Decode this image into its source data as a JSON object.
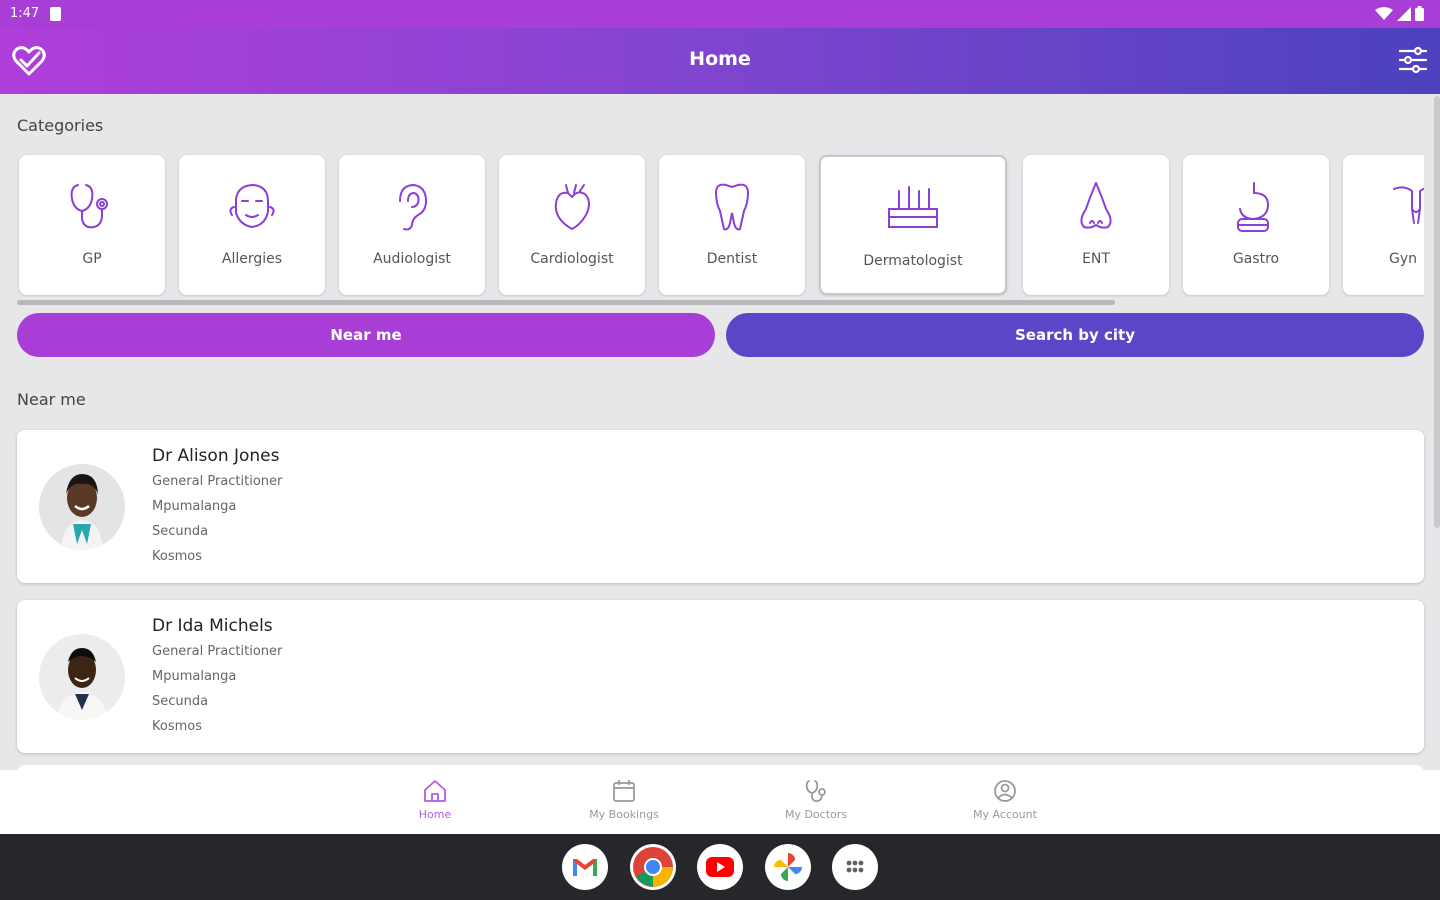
{
  "status_bar": {
    "time": "1:47"
  },
  "app_bar": {
    "title": "Home"
  },
  "sections": {
    "categories_title": "Categories",
    "near_title": "Near me"
  },
  "categories": [
    {
      "label": "GP",
      "icon": "stethoscope-icon"
    },
    {
      "label": "Allergies",
      "icon": "sneezing-face-icon"
    },
    {
      "label": "Audiologist",
      "icon": "ear-icon"
    },
    {
      "label": "Cardiologist",
      "icon": "heart-icon"
    },
    {
      "label": "Dentist",
      "icon": "tooth-icon"
    },
    {
      "label": "Dermatologist",
      "icon": "skin-layers-icon"
    },
    {
      "label": "ENT",
      "icon": "nose-icon"
    },
    {
      "label": "Gastro",
      "icon": "stomach-icon"
    },
    {
      "label": "Gyn",
      "icon": "uterus-icon"
    }
  ],
  "buttons": {
    "near_me": "Near me",
    "search_city": "Search by city"
  },
  "doctors": [
    {
      "name": "Dr Alison Jones",
      "specialty": "General Practitioner",
      "province": "Mpumalanga",
      "city": "Secunda",
      "suburb": "Kosmos"
    },
    {
      "name": "Dr Ida Michels",
      "specialty": "General Practitioner",
      "province": "Mpumalanga",
      "city": "Secunda",
      "suburb": "Kosmos"
    }
  ],
  "bottom_nav": [
    {
      "label": "Home",
      "icon": "home-icon",
      "active": true
    },
    {
      "label": "My Bookings",
      "icon": "calendar-icon",
      "active": false
    },
    {
      "label": "My Doctors",
      "icon": "stethoscope-icon",
      "active": false
    },
    {
      "label": "My Account",
      "icon": "account-icon",
      "active": false
    }
  ],
  "dock": [
    "gmail-icon",
    "chrome-icon",
    "youtube-icon",
    "photos-icon",
    "app-drawer-icon"
  ],
  "colors": {
    "purple": "#a93ed6",
    "indigo": "#5a47c8",
    "accent_icon": "#8b3fd6"
  }
}
